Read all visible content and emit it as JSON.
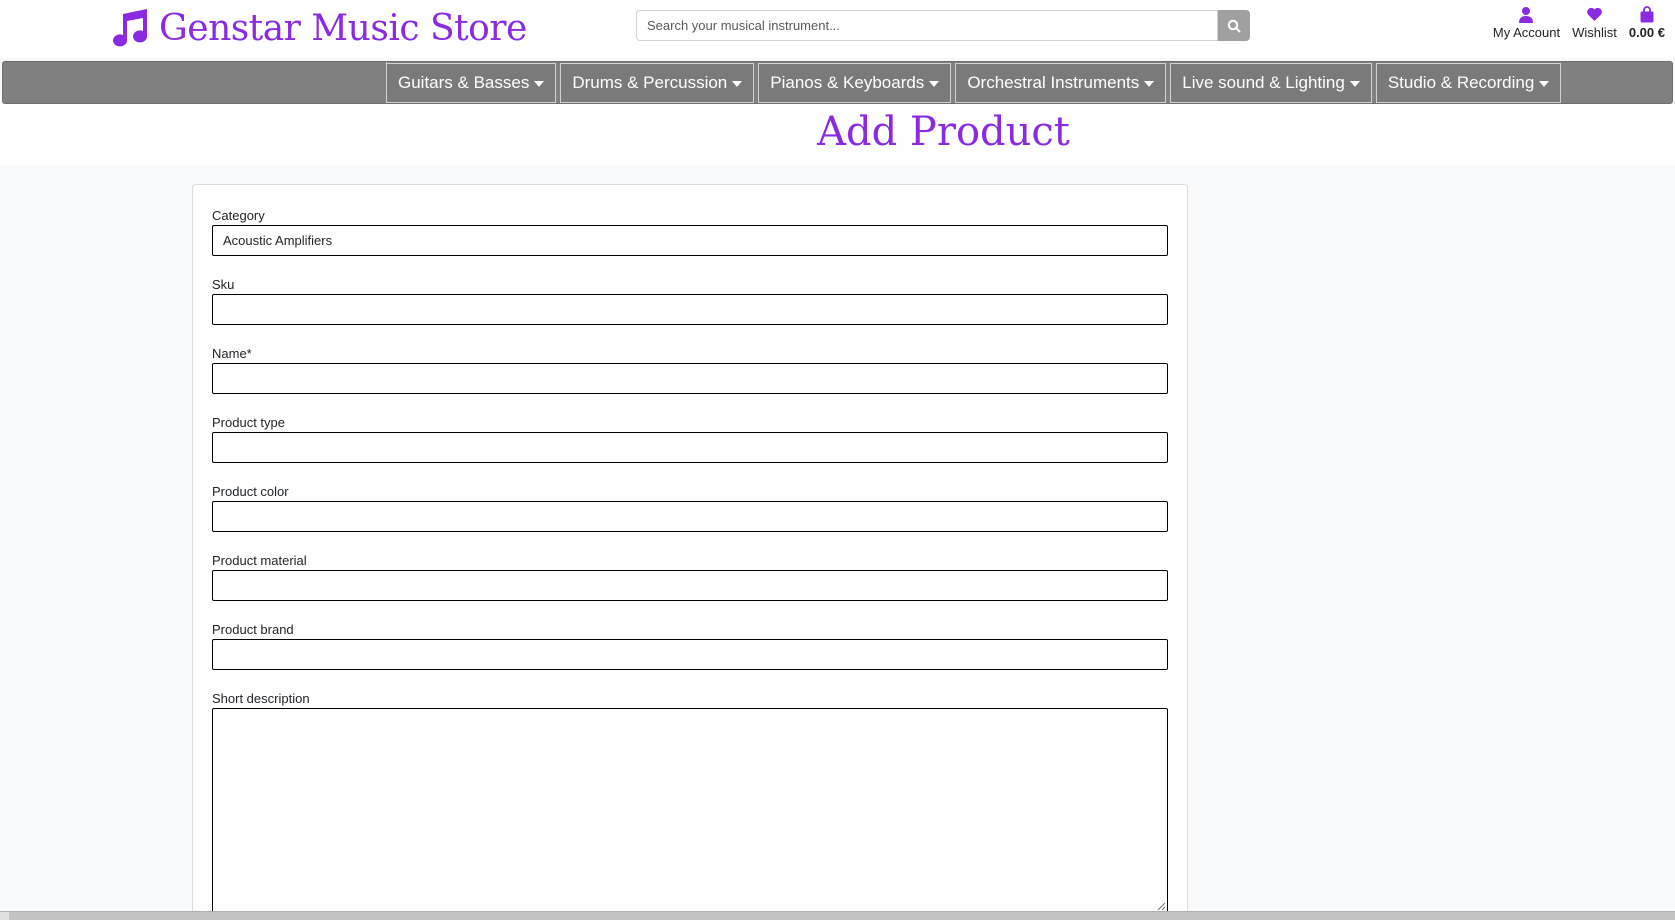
{
  "header": {
    "brand": "Genstar Music Store",
    "search_placeholder": "Search your musical instrument...",
    "account_label": "My Account",
    "wishlist_label": "Wishlist",
    "cart_total": "0.00 €"
  },
  "nav": {
    "items": [
      {
        "label": "Guitars & Basses"
      },
      {
        "label": "Drums & Percussion"
      },
      {
        "label": "Pianos & Keyboards"
      },
      {
        "label": "Orchestral Instruments"
      },
      {
        "label": "Live sound & Lighting"
      },
      {
        "label": "Studio & Recording"
      }
    ]
  },
  "page": {
    "title": "Add Product"
  },
  "form": {
    "category_label": "Category",
    "category_value": "Acoustic Amplifiers",
    "sku_label": "Sku",
    "name_label": "Name*",
    "product_type_label": "Product type",
    "product_color_label": "Product color",
    "product_material_label": "Product material",
    "product_brand_label": "Product brand",
    "short_description_label": "Short description"
  },
  "colors": {
    "brand": "#8a2be2",
    "nav_bg": "#808080",
    "search_button": "#a0a0a0"
  }
}
